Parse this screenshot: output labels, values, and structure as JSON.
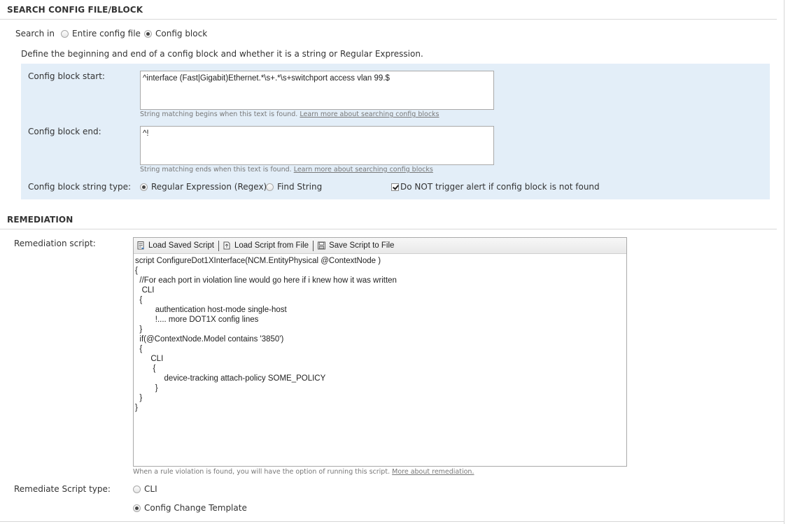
{
  "search_section": {
    "title": "SEARCH CONFIG FILE/BLOCK",
    "search_in_label": "Search in",
    "options": [
      {
        "label": "Entire config file",
        "selected": false
      },
      {
        "label": "Config block",
        "selected": true
      }
    ],
    "description": "Define the beginning and end of a config block and whether it is a string or Regular Expression.",
    "block_start": {
      "label": "Config block start:",
      "value": "^interface (Fast|Gigabit)Ethernet.*\\s+.*\\s+switchport access vlan 99.$",
      "hint": "String matching begins when this text is found.",
      "hint_link": "Learn more about searching config blocks"
    },
    "block_end": {
      "label": "Config block end:",
      "value": "^!",
      "hint": "String matching ends when this text is found.",
      "hint_link": "Learn more about searching config blocks"
    },
    "string_type": {
      "label": "Config block string type:",
      "options": [
        {
          "label": "Regular Expression (Regex)",
          "selected": true
        },
        {
          "label": "Find String",
          "selected": false
        }
      ],
      "checkbox_label": "Do NOT trigger alert if config block is not found",
      "checkbox_checked": true
    }
  },
  "remediation": {
    "title": "REMEDIATION",
    "script_label": "Remediation script:",
    "toolbar": {
      "load_saved": "Load Saved Script",
      "load_file": "Load Script from File",
      "save_file": "Save Script to File"
    },
    "script": "script ConfigureDot1XInterface(NCM.EntityPhysical @ContextNode )\n{\n  //For each port in violation line would go here if i knew how it was written\n   CLI\n  {\n         authentication host-mode single-host\n         !.... more DOT1X config lines\n  }\n  if(@ContextNode.Model contains '3850')\n  {\n       CLI\n        {\n             device-tracking attach-policy SOME_POLICY\n         }\n  }\n}",
    "hint": "When a rule violation is found, you will have the option of running this script.",
    "hint_link": "More about remediation.",
    "type_label": "Remediate Script type:",
    "type_options": [
      {
        "label": "CLI",
        "selected": false
      },
      {
        "label": "Config Change Template",
        "selected": true
      }
    ]
  }
}
